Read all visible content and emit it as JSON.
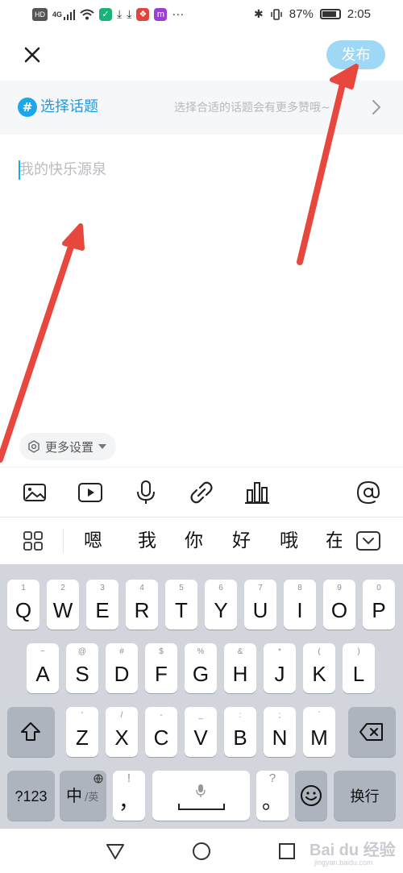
{
  "status_bar": {
    "left_tag": "HD",
    "network": "4G",
    "more": "···",
    "app_letter": "m",
    "battery_text": "87%",
    "battery_level": 0.87,
    "time": "2:05"
  },
  "header": {
    "close_icon": "close-icon",
    "publish_label": "发布"
  },
  "topic": {
    "icon_text": "#",
    "label": "选择话题",
    "hint": "选择合适的话题会有更多赞哦~"
  },
  "editor": {
    "placeholder": "我的快乐源泉",
    "more_settings": "更多设置"
  },
  "toolbar": {
    "items": [
      "image-icon",
      "video-icon",
      "microphone-icon",
      "link-icon",
      "chart-icon",
      "mention-icon"
    ]
  },
  "candidates": [
    "嗯",
    "我",
    "你",
    "好",
    "哦",
    "在"
  ],
  "keyboard": {
    "row1": [
      {
        "top": "1",
        "main": "Q"
      },
      {
        "top": "2",
        "main": "W"
      },
      {
        "top": "3",
        "main": "E"
      },
      {
        "top": "4",
        "main": "R"
      },
      {
        "top": "5",
        "main": "T"
      },
      {
        "top": "6",
        "main": "Y"
      },
      {
        "top": "7",
        "main": "U"
      },
      {
        "top": "8",
        "main": "I"
      },
      {
        "top": "9",
        "main": "O"
      },
      {
        "top": "0",
        "main": "P"
      }
    ],
    "row2": [
      {
        "top": "~",
        "main": "A"
      },
      {
        "top": "@",
        "main": "S"
      },
      {
        "top": "#",
        "main": "D"
      },
      {
        "top": "$",
        "main": "F"
      },
      {
        "top": "%",
        "main": "G"
      },
      {
        "top": "&",
        "main": "H"
      },
      {
        "top": "*",
        "main": "J"
      },
      {
        "top": "(",
        "main": "K"
      },
      {
        "top": ")",
        "main": "L"
      }
    ],
    "row3": [
      {
        "top": "'",
        "main": "Z"
      },
      {
        "top": "/",
        "main": "X"
      },
      {
        "top": "-",
        "main": "C"
      },
      {
        "top": "_",
        "main": "V"
      },
      {
        "top": ":",
        "main": "B"
      },
      {
        "top": ";",
        "main": "N"
      },
      {
        "top": "`",
        "main": "M"
      }
    ],
    "symbols_label": "?123",
    "lang_main": "中",
    "lang_sub": "/英",
    "comma_top": "!",
    "comma_main": "，",
    "period_top": "?",
    "period_main": "。",
    "enter_label": "换行"
  },
  "watermark": {
    "text": "Bai du 经验",
    "sub": "jingyan.baidu.com"
  },
  "colors": {
    "accent": "#1aa7ec",
    "publish_disabled": "#9fd8f5",
    "annotation_arrow": "#e8473d",
    "keyboard_bg": "#d2d5dc"
  }
}
